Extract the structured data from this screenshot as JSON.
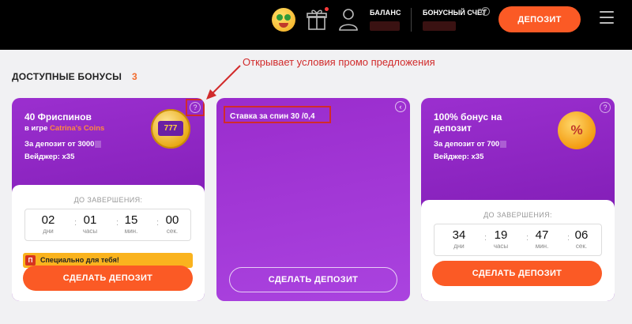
{
  "header": {
    "balance_label": "БАЛАНС",
    "bonus_account_label": "БОНУСНЫЙ СЧЁТ",
    "bonus_help": "?",
    "deposit_label": "ДЕПОЗИТ"
  },
  "annotation": {
    "text": "Открывает условия промо предложения"
  },
  "section": {
    "title": "ДОСТУПНЫЕ БОНУСЫ",
    "count": "3"
  },
  "cards": [
    {
      "title": "40 Фриспинов",
      "game_prefix": "в игре",
      "game_name": "Catrina's Coins",
      "deposit_text": "За депозит от 3000",
      "wager_text": "Вейджер: x35",
      "help": "?",
      "slot_label": "777",
      "timer_caption": "ДО ЗАВЕРШЕНИЯ:",
      "timer": [
        {
          "value": "02",
          "unit": "дни"
        },
        {
          "value": "01",
          "unit": "часы"
        },
        {
          "value": "15",
          "unit": "мин."
        },
        {
          "value": "00",
          "unit": "сек."
        }
      ],
      "special_icon": "П",
      "special_text": "Специально для тебя!",
      "cta_label": "СДЕЛАТЬ ДЕПОЗИТ"
    },
    {
      "promo_text": "Ставка за спин 30 /0,4",
      "back_icon": "‹",
      "cta_label": "СДЕЛАТЬ ДЕПОЗИТ"
    },
    {
      "title_line1": "100% бонус на",
      "title_line2": "депозит",
      "deposit_text": "За депозит от 700",
      "wager_text": "Вейджер: x35",
      "help": "?",
      "coin_label": "%",
      "timer_caption": "ДО ЗАВЕРШЕНИЯ:",
      "timer": [
        {
          "value": "34",
          "unit": "дни"
        },
        {
          "value": "19",
          "unit": "часы"
        },
        {
          "value": "47",
          "unit": "мин."
        },
        {
          "value": "06",
          "unit": "сек."
        }
      ],
      "cta_label": "СДЕЛАТЬ ДЕПОЗИТ"
    }
  ],
  "colors": {
    "accent": "#fb5a25",
    "card_purple": "#8a22c0",
    "annotation_red": "#d12b2b",
    "special_yellow": "#fab31e"
  }
}
